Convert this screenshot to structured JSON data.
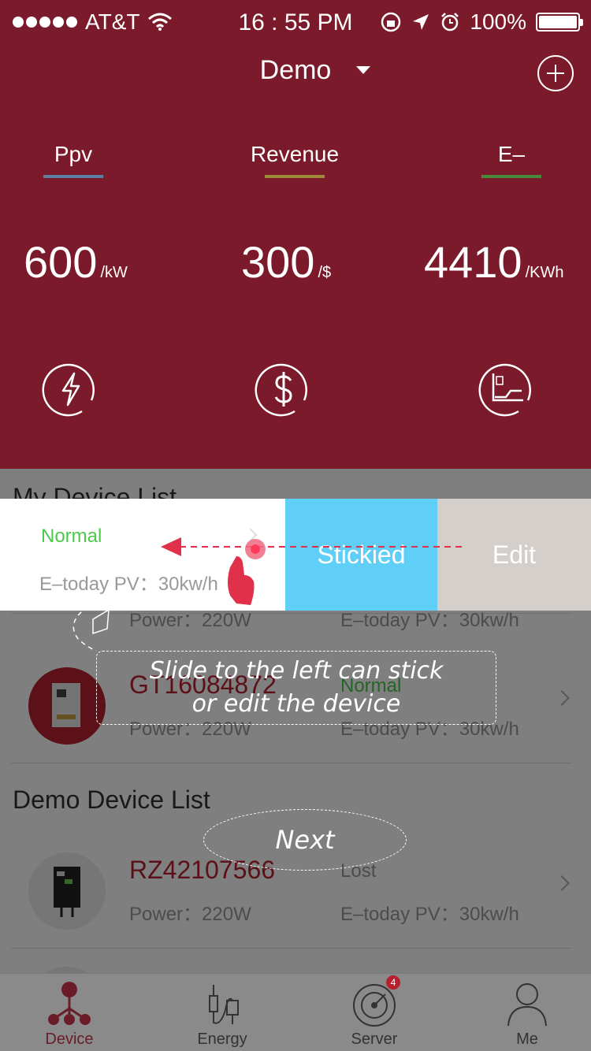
{
  "status_bar": {
    "carrier": "AT&T",
    "time": "16 : 55 PM",
    "battery": "100%",
    "battery_level": 1.0
  },
  "header": {
    "title": "Demo",
    "tabs": [
      {
        "label": "Ppv",
        "color": "#5b7fa0"
      },
      {
        "label": "Revenue",
        "color": "#a08a3a"
      },
      {
        "label": "E–",
        "color": "#4a8a3a"
      }
    ],
    "metrics": [
      {
        "value": "600",
        "unit": "/kW"
      },
      {
        "value": "300",
        "unit": "/$"
      },
      {
        "value": "4410",
        "unit": "/KWh"
      }
    ],
    "icons": [
      "lightning-icon",
      "dollar-icon",
      "chart-icon"
    ]
  },
  "my_device_list": {
    "title": "My Device List",
    "swipe_row": {
      "status": "Normal",
      "etoday": "E–today PV：30kw/h",
      "actions": {
        "stick": "Stickied",
        "edit": "Edit"
      }
    },
    "hidden_row": {
      "power": "Power：220W",
      "etoday": "E–today PV：30kw/h"
    },
    "rows": [
      {
        "name": "GT16084872",
        "status": "Normal",
        "power": "Power：220W",
        "etoday": "E–today PV：30kw/h"
      }
    ]
  },
  "demo_device_list": {
    "title": "Demo Device List",
    "rows": [
      {
        "name": "RZ42107566",
        "status": "Lost",
        "power": "Power：220W",
        "etoday": "E–today PV：30kw/h"
      }
    ]
  },
  "guide": {
    "line1": "Slide to the left can stick",
    "line2": "or edit the device",
    "next": "Next"
  },
  "tab_bar": {
    "items": [
      {
        "label": "Device",
        "icon": "device-icon"
      },
      {
        "label": "Energy",
        "icon": "energy-icon"
      },
      {
        "label": "Server",
        "icon": "server-icon",
        "badge": "4"
      },
      {
        "label": "Me",
        "icon": "user-icon"
      }
    ]
  },
  "colors": {
    "header_bg": "#7a1a2a",
    "accent": "#b8202e",
    "stick_bg": "#5fcff8",
    "edit_bg": "#d5cfcc",
    "status_normal": "#4cc94c"
  }
}
